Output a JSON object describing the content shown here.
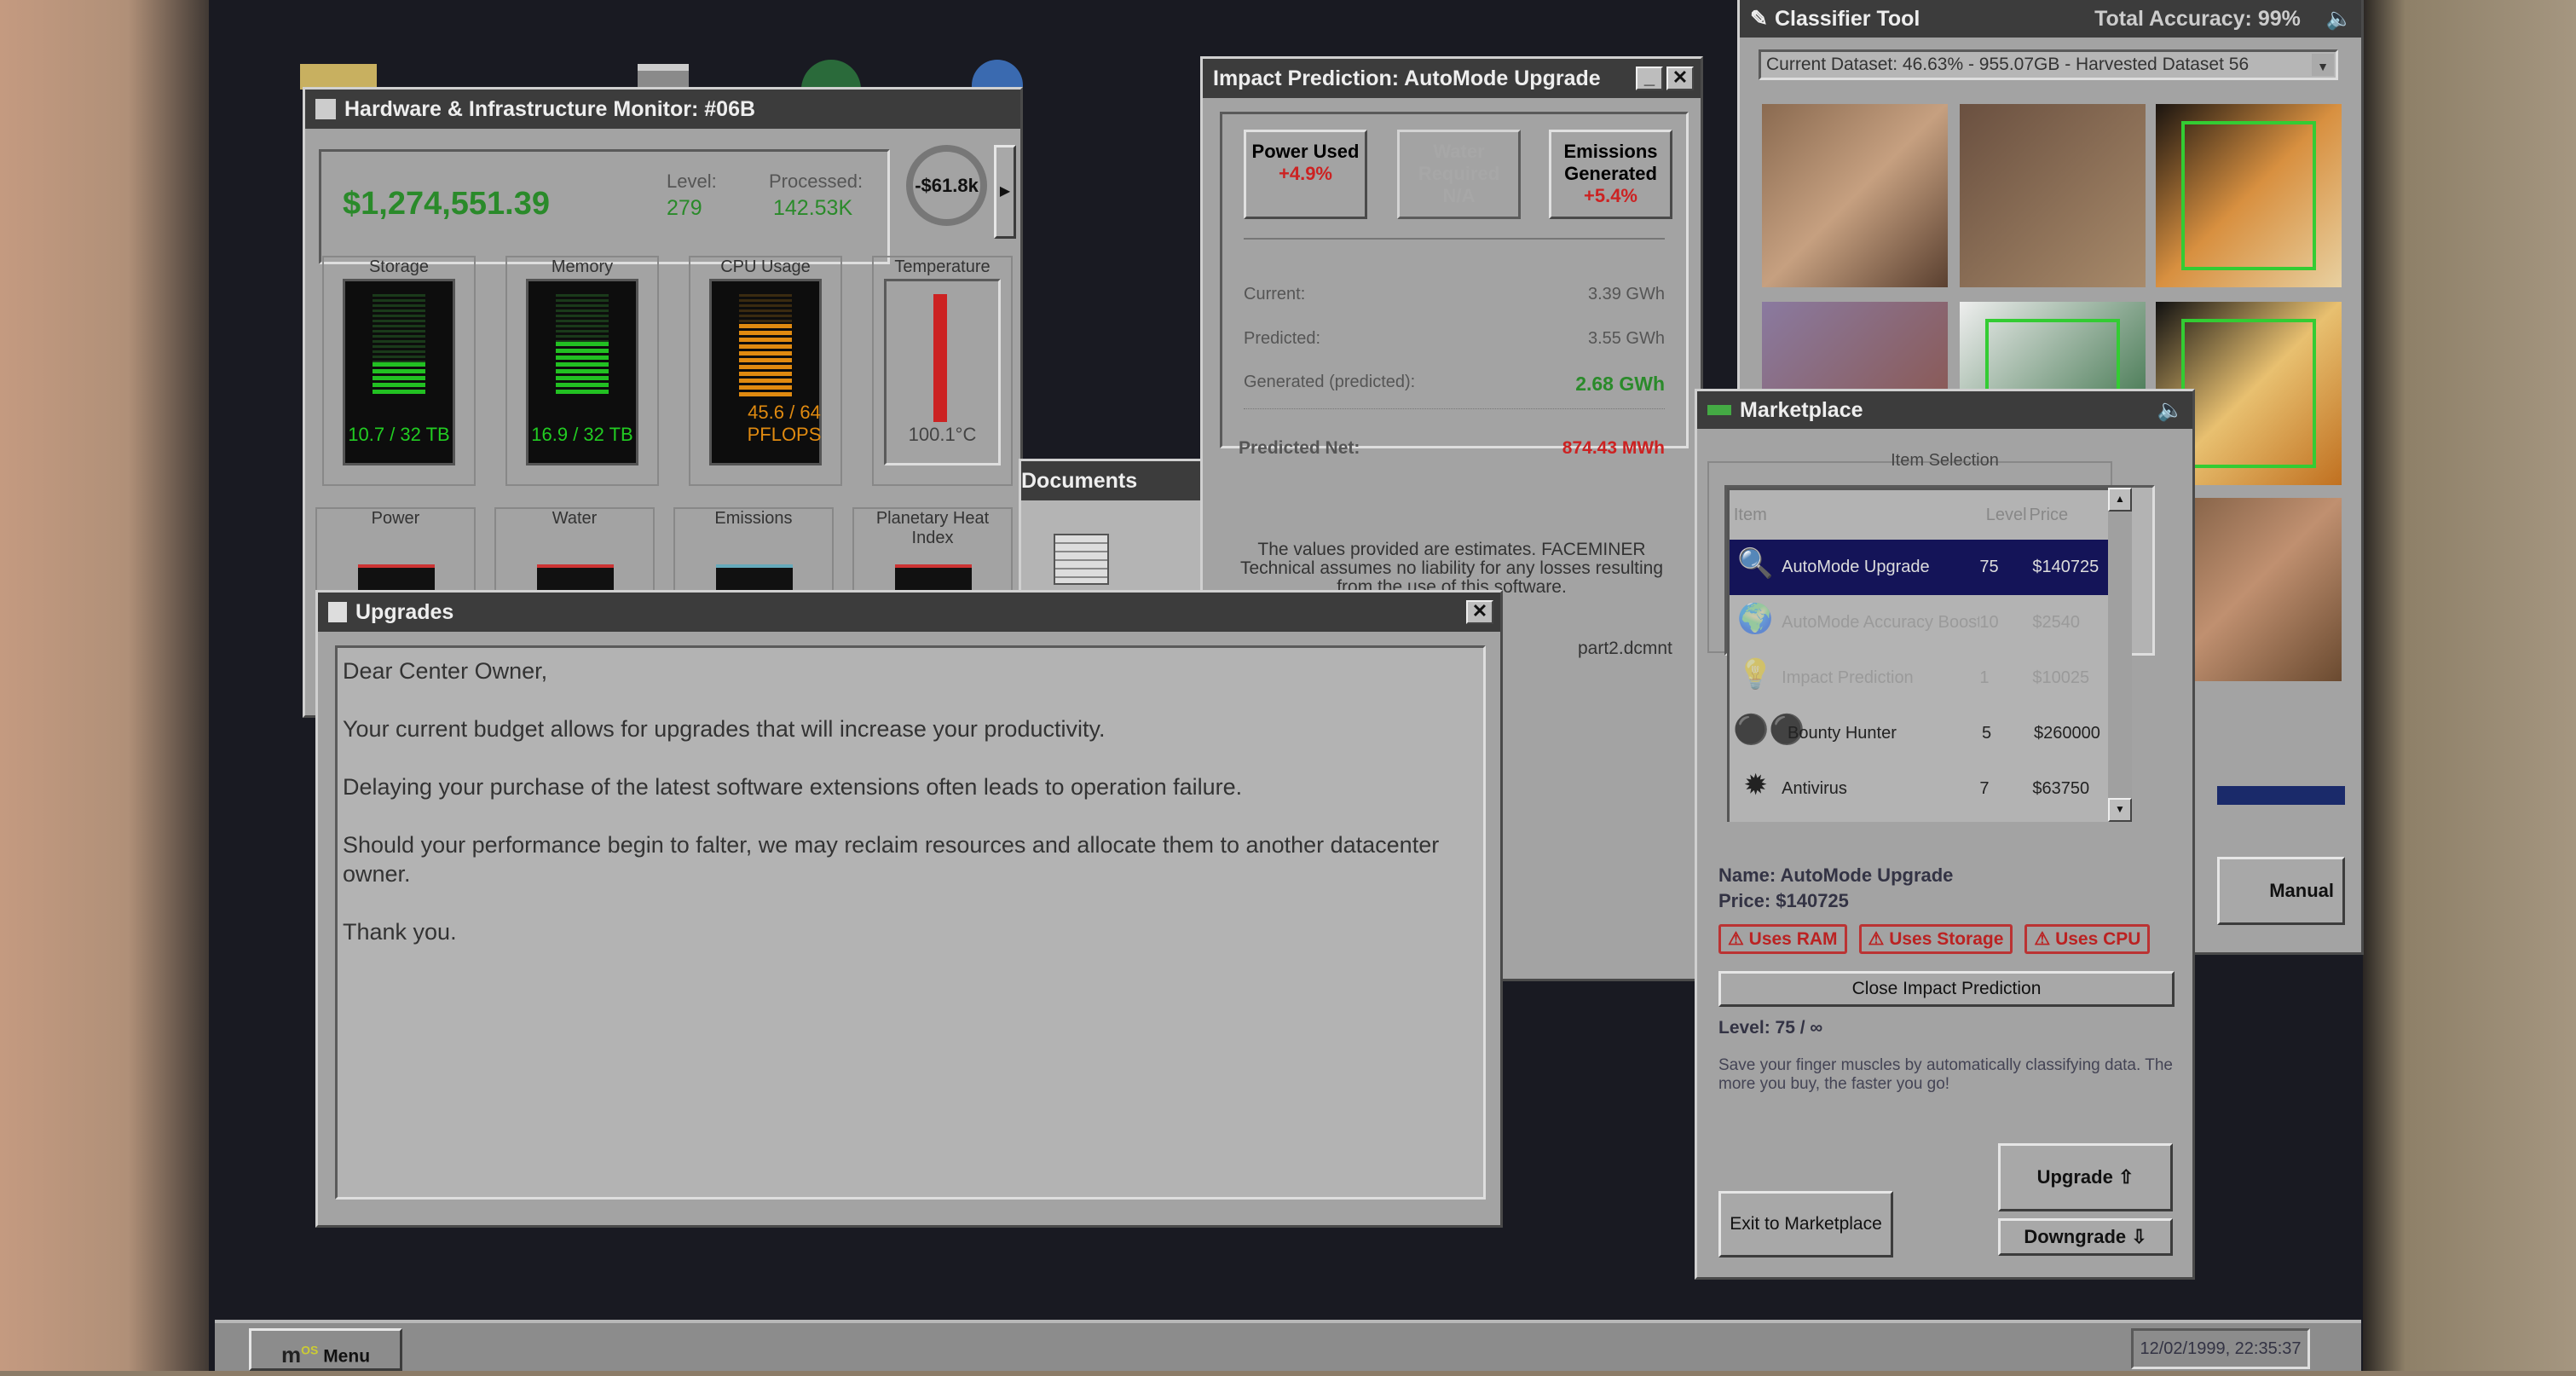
{
  "hw_monitor": {
    "title": "Hardware & Infrastructure Monitor: #06B",
    "money": "$1,274,551.39",
    "level_label": "Level:",
    "level": "279",
    "processed_label": "Processed:",
    "processed": "142.53K",
    "rate": "-$61.8k",
    "gauges": [
      {
        "label": "Storage",
        "value": "10.7 / 32 TB",
        "fill": 0.33
      },
      {
        "label": "Memory",
        "value": "16.9 / 32 TB",
        "fill": 0.53
      },
      {
        "label": "CPU Usage",
        "value": "45.6 / 64 PFLOPS",
        "fill": 0.71
      },
      {
        "label": "Temperature",
        "value": "100.1°C",
        "fill": 1.0
      }
    ],
    "graphs": [
      "Power",
      "Water",
      "Emissions",
      "Planetary Heat Index"
    ]
  },
  "impact": {
    "title": "Impact Prediction: AutoMode Upgrade",
    "cards": [
      {
        "label": "Power Used",
        "value": "+4.9%"
      },
      {
        "label": "Water Required",
        "value": "N/A"
      },
      {
        "label": "Emissions Generated",
        "value": "+5.4%"
      }
    ],
    "rows": [
      {
        "label": "Current:",
        "value": "3.39 GWh"
      },
      {
        "label": "Predicted:",
        "value": "3.55 GWh"
      },
      {
        "label": "Generated (predicted):",
        "value": "2.68 GWh"
      }
    ],
    "net_label": "Predicted Net:",
    "net_value": "874.43 MWh",
    "disclaimer": "The values provided are estimates. FACEMINER Technical assumes no liability for any losses resulting from the use of this software."
  },
  "documents": {
    "title": "Documents",
    "file": "part2.dcmnt"
  },
  "upgrades": {
    "title": "Upgrades",
    "paragraphs": [
      "Dear Center Owner,",
      "Your current budget allows for upgrades that will increase your productivity.",
      "Delaying your purchase of the latest software extensions often leads to operation failure.",
      "Should your performance begin to falter, we may reclaim resources and allocate them to another datacenter owner.",
      "Thank you."
    ]
  },
  "classifier": {
    "title": "Classifier Tool",
    "accuracy": "Total Accuracy: 99%",
    "dataset": "Current Dataset: 46.63% - 955.07GB - Harvested Dataset 56",
    "manual_mode": "Manual Mode"
  },
  "marketplace": {
    "title": "Marketplace",
    "group": "Item Selection",
    "col_item": "Item",
    "col_level": "Level",
    "col_price": "Price",
    "items": [
      {
        "name": "AutoMode Upgrade",
        "level": "75",
        "price": "$140725",
        "icon": "magnifier-folder-icon"
      },
      {
        "name": "AutoMode Accuracy Booster",
        "level": "10",
        "price": "$2540",
        "icon": "globe-person-icon"
      },
      {
        "name": "Impact Prediction",
        "level": "1",
        "price": "$10025",
        "icon": "lightbulb-icon"
      },
      {
        "name": "Bounty Hunter",
        "level": "5",
        "price": "$260000",
        "icon": "binoculars-icon"
      },
      {
        "name": "Antivirus",
        "level": "7",
        "price": "$63750",
        "icon": "virus-icon"
      }
    ],
    "detail_name": "Name: AutoMode Upgrade",
    "detail_price": "Price: $140725",
    "tags": [
      "⚠ Uses RAM",
      "⚠ Uses Storage",
      "⚠ Uses CPU"
    ],
    "close_impact": "Close Impact Prediction",
    "level_text": "Level: 75 / ∞",
    "description": "Save your finger muscles by automatically classifying data. The more you buy, the faster you go!",
    "upgrade": "Upgrade ⇧",
    "downgrade": "Downgrade ⇩",
    "exit": "Exit to Marketplace"
  },
  "taskbar": {
    "menu": "Menu",
    "clock": "12/02/1999, 22:35:37"
  }
}
